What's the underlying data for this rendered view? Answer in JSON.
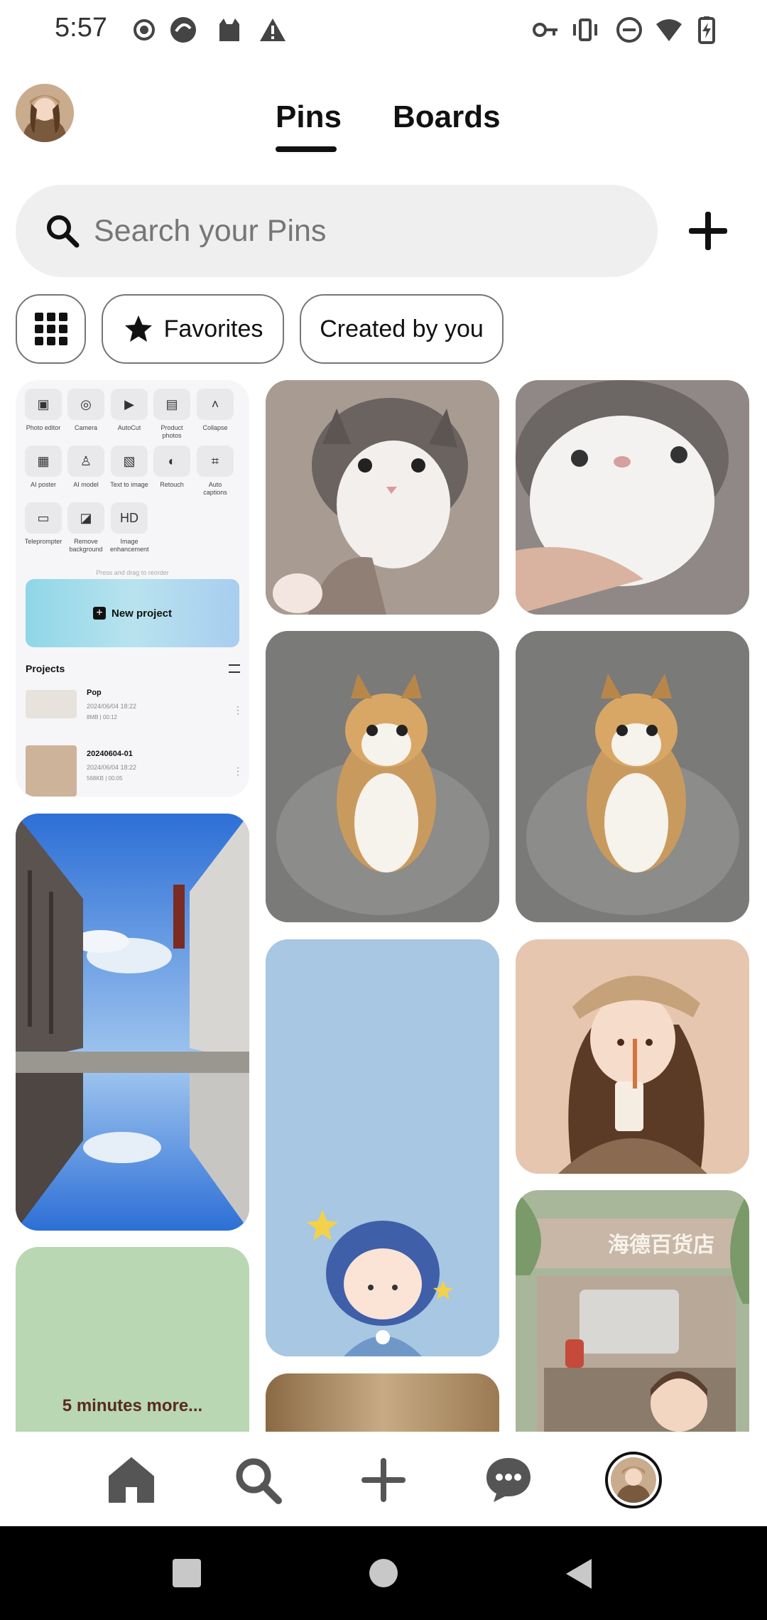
{
  "status_bar": {
    "time": "5:57"
  },
  "header": {
    "tabs": [
      {
        "label": "Pins",
        "active": true
      },
      {
        "label": "Boards",
        "active": false
      }
    ]
  },
  "search": {
    "placeholder": "Search your Pins"
  },
  "filters": {
    "favorites_label": "Favorites",
    "created_label": "Created by you"
  },
  "pins": {
    "editor": {
      "tools": [
        {
          "label": "Photo editor",
          "icon": "photo-edit-icon"
        },
        {
          "label": "Camera",
          "icon": "camera-icon"
        },
        {
          "label": "AutoCut",
          "icon": "autocut-icon"
        },
        {
          "label": "Product photos",
          "icon": "product-icon"
        },
        {
          "label": "Collapse",
          "icon": "chevron-up-icon"
        },
        {
          "label": "AI poster",
          "icon": "poster-icon"
        },
        {
          "label": "AI model",
          "icon": "model-icon"
        },
        {
          "label": "Text to image",
          "icon": "text-image-icon"
        },
        {
          "label": "Retouch",
          "icon": "retouch-icon"
        },
        {
          "label": "Auto captions",
          "icon": "captions-icon"
        },
        {
          "label": "Teleprompter",
          "icon": "teleprompter-icon"
        },
        {
          "label": "Remove background",
          "icon": "remove-bg-icon"
        },
        {
          "label": "Image enhancement",
          "icon": "enhance-icon"
        }
      ],
      "hint": "Press and drag to reorder",
      "new_project": "New project",
      "projects_title": "Projects",
      "projects": [
        {
          "name": "Pop",
          "date": "2024/06/04 18:22",
          "meta": "8MB  |  00:12"
        },
        {
          "name": "20240604-01",
          "date": "2024/06/04 18:22",
          "meta": "568KB  |  00:05"
        }
      ]
    },
    "quote_text": "5 minutes more...",
    "store_sign": "海德百货店"
  },
  "colors": {
    "accent": "#111111",
    "search_bg": "#efefef",
    "chip_border": "#767676"
  }
}
